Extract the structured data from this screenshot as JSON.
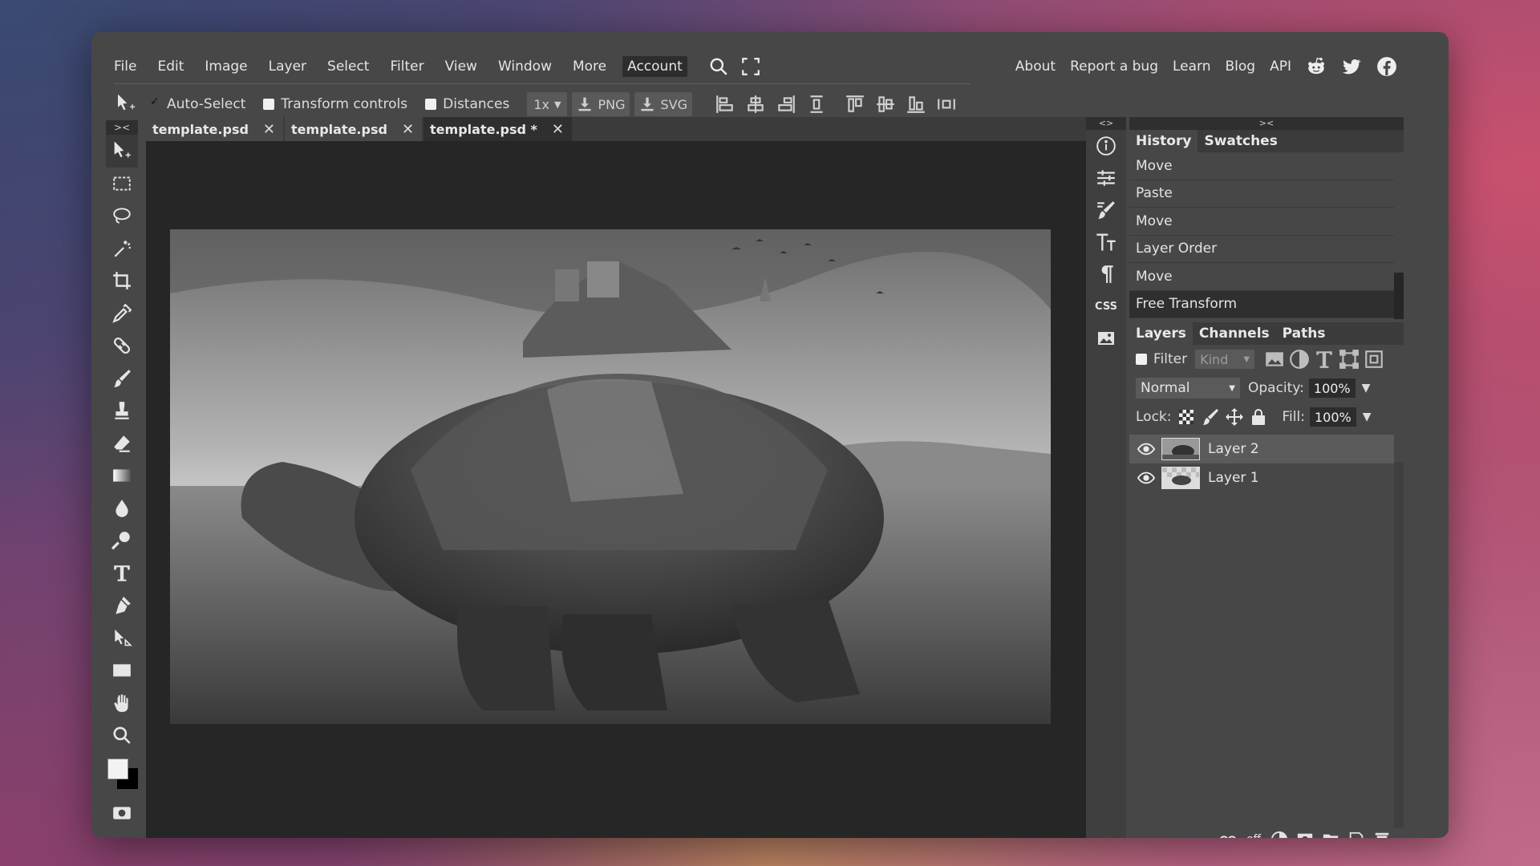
{
  "menu": {
    "items": [
      "File",
      "Edit",
      "Image",
      "Layer",
      "Select",
      "Filter",
      "View",
      "Window",
      "More",
      "Account"
    ],
    "active": "Account",
    "right_links": [
      "About",
      "Report a bug",
      "Learn",
      "Blog",
      "API"
    ],
    "icons": [
      "search-icon",
      "fullscreen-icon",
      "reddit-icon",
      "twitter-icon",
      "facebook-icon"
    ]
  },
  "options": {
    "auto_select": "Auto-Select",
    "transform_controls": "Transform controls",
    "distances": "Distances",
    "zoom": "1x",
    "png": "PNG",
    "svg": "SVG"
  },
  "tabs": [
    {
      "label": "template.psd"
    },
    {
      "label": "template.psd"
    },
    {
      "label": "template.psd *"
    }
  ],
  "panel_arrows": {
    "left": "><",
    "mid": "<>",
    "right": "><"
  },
  "history": {
    "tabs": [
      "History",
      "Swatches"
    ],
    "items": [
      "Move",
      "Paste",
      "Move",
      "Layer Order",
      "Move",
      "Free Transform"
    ]
  },
  "layers": {
    "tabs": [
      "Layers",
      "Channels",
      "Paths"
    ],
    "filter_label": "Filter",
    "kind_placeholder": "Kind",
    "blend_mode": "Normal",
    "opacity_label": "Opacity:",
    "opacity": "100%",
    "lock_label": "Lock:",
    "fill_label": "Fill:",
    "fill": "100%",
    "items": [
      "Layer 2",
      "Layer 1"
    ],
    "selected": "Layer 2"
  },
  "mini_icons": {
    "css": "CSS"
  },
  "bottom_bar": {
    "eff": "eff"
  },
  "colors": {
    "foreground": "#f2f2f2",
    "background": "#000000"
  }
}
